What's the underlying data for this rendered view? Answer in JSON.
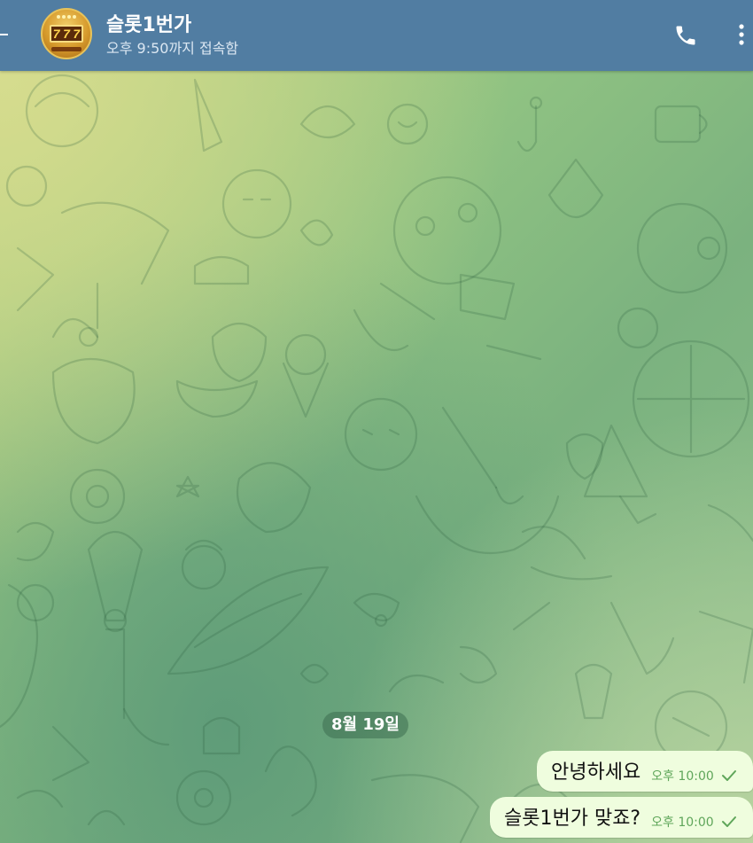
{
  "header": {
    "title": "슬롯1번가",
    "status": "오후 9:50까지 접속함",
    "avatar_icon": "slot-machine-777-icon",
    "avatar_text": [
      "7",
      "7",
      "7"
    ],
    "call_icon": "phone-icon",
    "menu_icon": "more-vertical-icon",
    "accent_color": "#517da2"
  },
  "chat": {
    "date_label": "8월 19일",
    "messages": [
      {
        "text": "안녕하세요",
        "time": "오후 10:00",
        "status": "sent-check"
      },
      {
        "text": "슬롯1번가 맞죠?",
        "time": "오후 10:00",
        "status": "sent-check"
      }
    ],
    "bubble_color": "#effdde",
    "time_color": "#5fa65a"
  }
}
